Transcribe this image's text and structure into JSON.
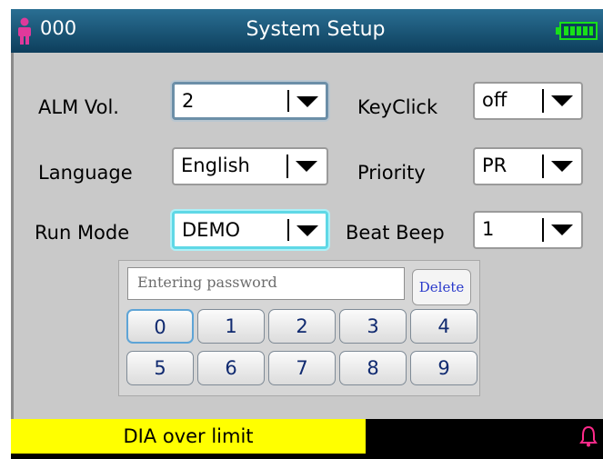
{
  "header": {
    "patient_id": "000",
    "title": "System Setup",
    "battery_icon": "battery-full-icon",
    "accent": "#0d3e5c"
  },
  "settings": {
    "alm_vol": {
      "label": "ALM Vol.",
      "value": "2"
    },
    "keyclick": {
      "label": "KeyClick",
      "value": "off"
    },
    "language": {
      "label": "Language",
      "value": "English"
    },
    "priority": {
      "label": "Priority",
      "value": "PR"
    },
    "run_mode": {
      "label": "Run Mode",
      "value": "DEMO"
    },
    "beat_beep": {
      "label": "Beat Beep",
      "value": "1"
    }
  },
  "keypad": {
    "placeholder": "Entering password",
    "delete_label": "Delete",
    "keys": [
      "0",
      "1",
      "2",
      "3",
      "4",
      "5",
      "6",
      "7",
      "8",
      "9"
    ]
  },
  "status": {
    "alarm_text": "DIA over limit",
    "alarm_color": "#ffff00",
    "bell_color": "#ff2a8a"
  }
}
